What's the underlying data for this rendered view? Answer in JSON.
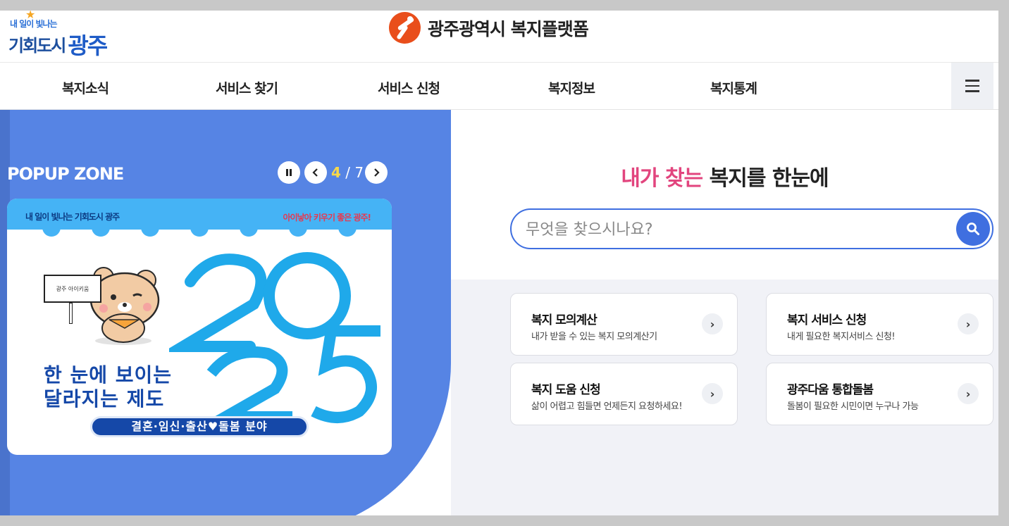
{
  "header": {
    "left_logo_small": "내 일이 빛나는",
    "left_logo_big": "기회도시",
    "left_logo_city": "광주",
    "site_title": "광주광역시 복지플랫폼"
  },
  "nav": {
    "items": [
      "복지소식",
      "서비스 찾기",
      "서비스 신청",
      "복지정보",
      "복지통계"
    ]
  },
  "popup": {
    "title": "POPUP ZONE",
    "current": "4",
    "separator": "/",
    "total": "7",
    "banner": {
      "brand": "내 일이 빛나는 기회도시 광주",
      "slogan": "아이낳아 키우기 좋은 광주!",
      "sign_text": "광주 아이키움",
      "year_top": "20",
      "year_bottom": "25",
      "line1": "한 눈에 보이는",
      "line2": "달라지는 제도",
      "pill": "결혼·임신·출산♥돌봄 분야"
    }
  },
  "hero": {
    "title_highlight": "내가 찾는",
    "title_rest": " 복지를 한눈에"
  },
  "search": {
    "placeholder": "무엇을 찾으시나요?"
  },
  "cards": [
    {
      "title": "복지 모의계산",
      "desc": "내가 받을 수 있는 복지 모의계산기"
    },
    {
      "title": "복지 서비스 신청",
      "desc": "내게 필요한 복지서비스 신청!"
    },
    {
      "title": "복지 도움 신청",
      "desc": "삶이 어렵고 힘들면 언제든지 요청하세요!"
    },
    {
      "title": "광주다움 통합돌봄",
      "desc": "돌봄이 필요한 시민이면 누구나 가능"
    }
  ],
  "colors": {
    "accent_blue": "#3f6fe0",
    "popup_bg": "#5684e4",
    "highlight_pink": "#e2457e",
    "brand_orange": "#e94e1b"
  }
}
